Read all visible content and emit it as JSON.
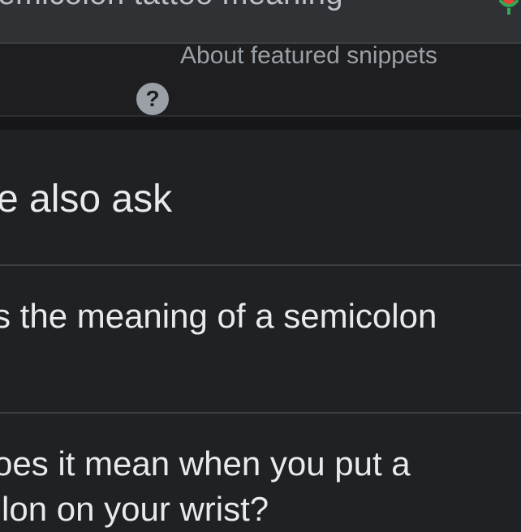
{
  "header": {
    "query_text": "semicolon tattoo meaning",
    "mic_icon": "mic-icon"
  },
  "featured_snippet": {
    "info_icon": "help-circle-icon",
    "label": "About featured snippets"
  },
  "people_also_ask": {
    "title": "e also ask",
    "questions": [
      {
        "text": "s the meaning of a semicolon"
      },
      {
        "line1": "oes it mean when you put a",
        "line2": "lon on your wrist?"
      }
    ]
  },
  "colors": {
    "background": "#202124",
    "topbar": "#303134",
    "text": "#e8eaed",
    "muted_text": "#9aa0a6",
    "divider": "#3c4043"
  }
}
